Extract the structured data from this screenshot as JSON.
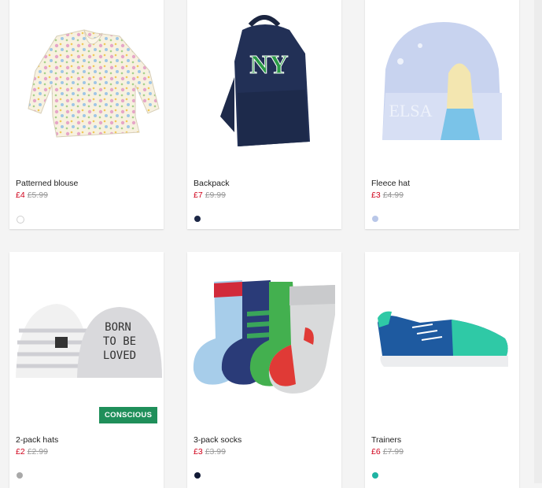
{
  "products": [
    {
      "name": "Patterned blouse",
      "price": "£4",
      "old_price": "£5.99",
      "swatch": "#ffffff",
      "swatch_border": "#cfcfcf"
    },
    {
      "name": "Backpack",
      "price": "£7",
      "old_price": "£9.99",
      "swatch": "#1c2746",
      "swatch_border": "#1c2746"
    },
    {
      "name": "Fleece hat",
      "price": "£3",
      "old_price": "£4.99",
      "swatch": "#b9c7e8",
      "swatch_border": "#b9c7e8"
    },
    {
      "name": "2-pack hats",
      "price": "£2",
      "old_price": "£2.99",
      "swatch": "#a9a9a9",
      "swatch_border": "#a9a9a9",
      "badge": "CONSCIOUS"
    },
    {
      "name": "3-pack socks",
      "price": "£3",
      "old_price": "£3.99",
      "swatch": "#121a36",
      "swatch_border": "#121a36"
    },
    {
      "name": "Trainers",
      "price": "£6",
      "old_price": "£7.99",
      "swatch": "#1fb3a3",
      "swatch_border": "#1fb3a3"
    }
  ],
  "images": {
    "backpack_logo": "NY",
    "hat_text": "ELSA",
    "beanie_text_line1": "BORN",
    "beanie_text_line2": "TO BE",
    "beanie_text_line3": "LOVED"
  },
  "colors": {
    "sale_price": "#d0021b",
    "badge": "#1f8f5a"
  }
}
